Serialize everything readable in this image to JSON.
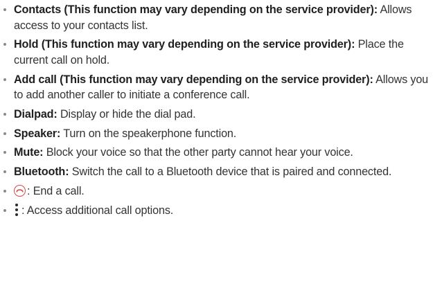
{
  "items": [
    {
      "term": "Contacts (This function may vary depending on the service provider)",
      "separator": ":",
      "desc": " Allows access to your contacts list."
    },
    {
      "term": "Hold (This function may vary depending on the service provider)",
      "separator": ":",
      "desc": " Place the current call on hold."
    },
    {
      "term": "Add call (This function may vary depending on the service provider)",
      "separator": ":",
      "desc": " Allows you to add another caller to initiate a conference call."
    },
    {
      "term": "Dialpad",
      "separator": ":",
      "desc": " Display or hide the dial pad."
    },
    {
      "term": "Speaker",
      "separator": ":",
      "desc": " Turn on the speakerphone function."
    },
    {
      "term": "Mute",
      "separator": ":",
      "desc": " Block your voice so that the other party cannot hear your voice."
    },
    {
      "term": "Bluetooth",
      "separator": ":",
      "desc": " Switch the call to a Bluetooth device that is paired and connected."
    }
  ],
  "icon_items": [
    {
      "icon": "end-call-icon",
      "icon_color": "#d24a4a",
      "desc": ": End a call."
    },
    {
      "icon": "more-options-icon",
      "desc": ": Access additional call options."
    }
  ]
}
